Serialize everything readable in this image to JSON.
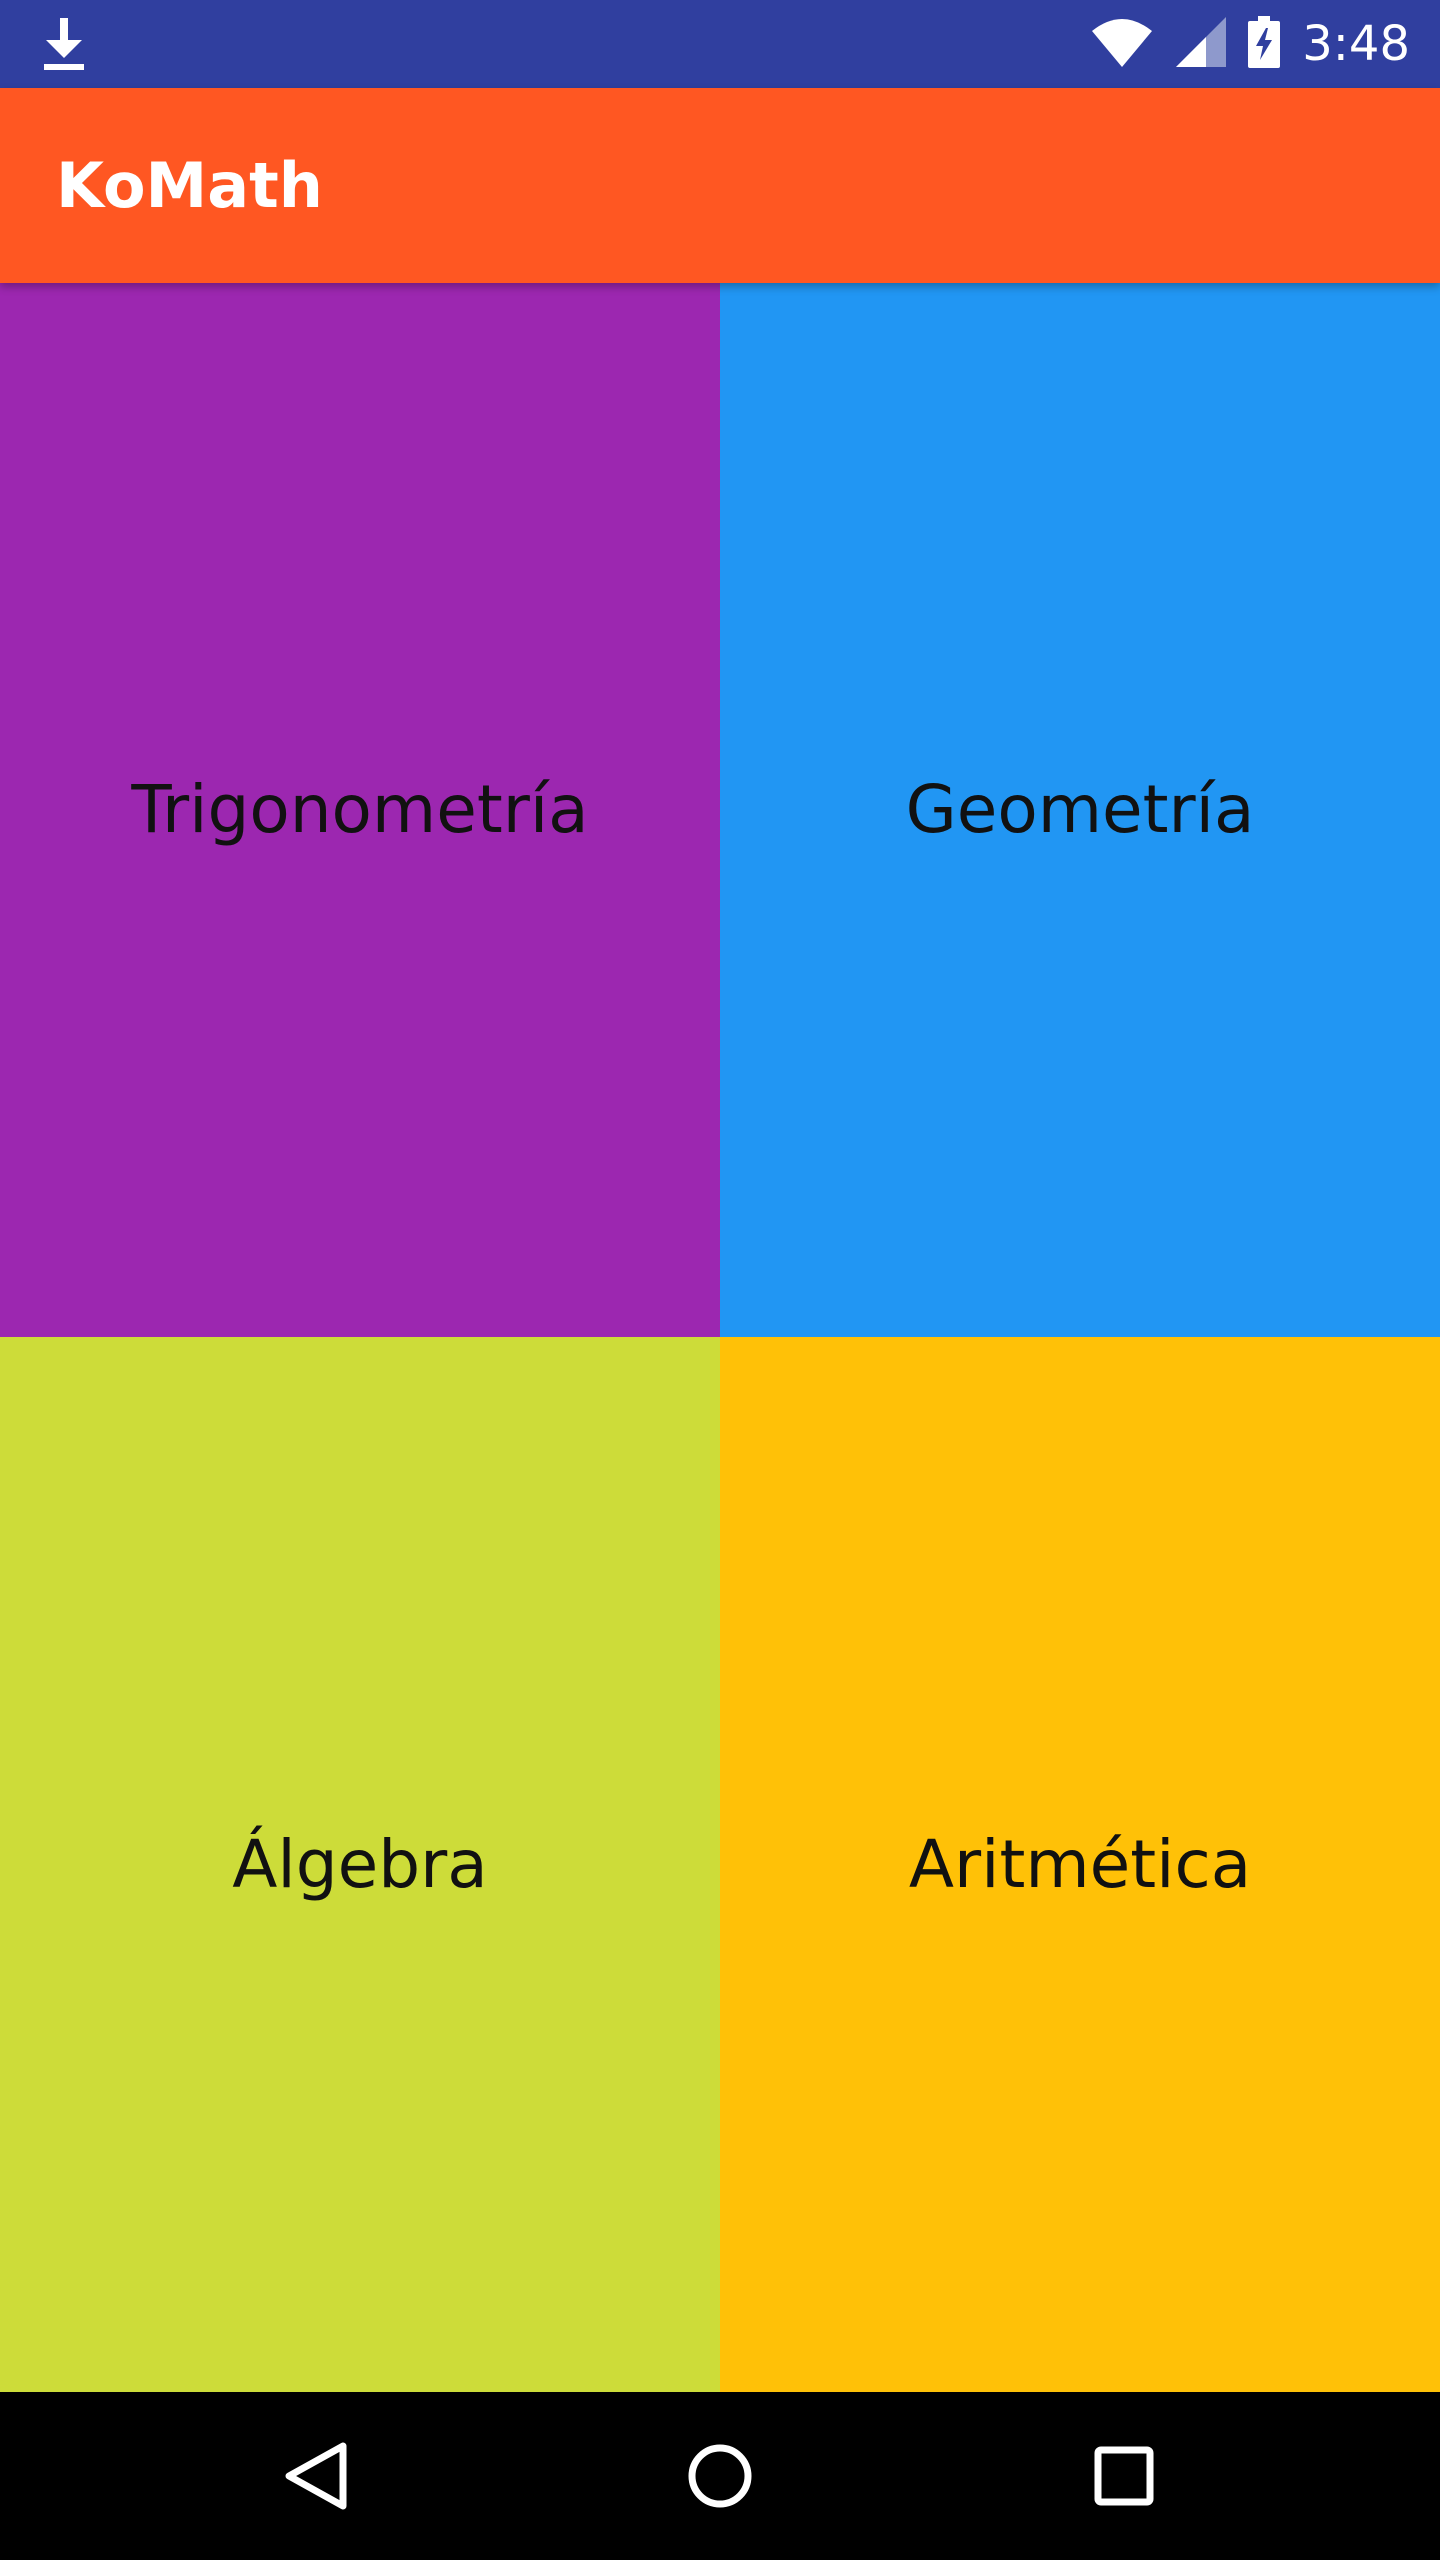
{
  "status_bar": {
    "time": "3:48",
    "color": "#303f9f",
    "icons": [
      "download-icon",
      "wifi-icon",
      "cell-signal-icon",
      "battery-charging-icon"
    ]
  },
  "app_bar": {
    "title": "KoMath",
    "color": "#ff5722"
  },
  "tiles": [
    {
      "label": "Trigonometría",
      "color": "#9c27b0"
    },
    {
      "label": "Geometría",
      "color": "#2196f3"
    },
    {
      "label": "Álgebra",
      "color": "#cddc39"
    },
    {
      "label": "Aritmética",
      "color": "#ffc107"
    }
  ],
  "nav_bar": {
    "icons": [
      "back-icon",
      "home-icon",
      "recents-icon"
    ]
  }
}
